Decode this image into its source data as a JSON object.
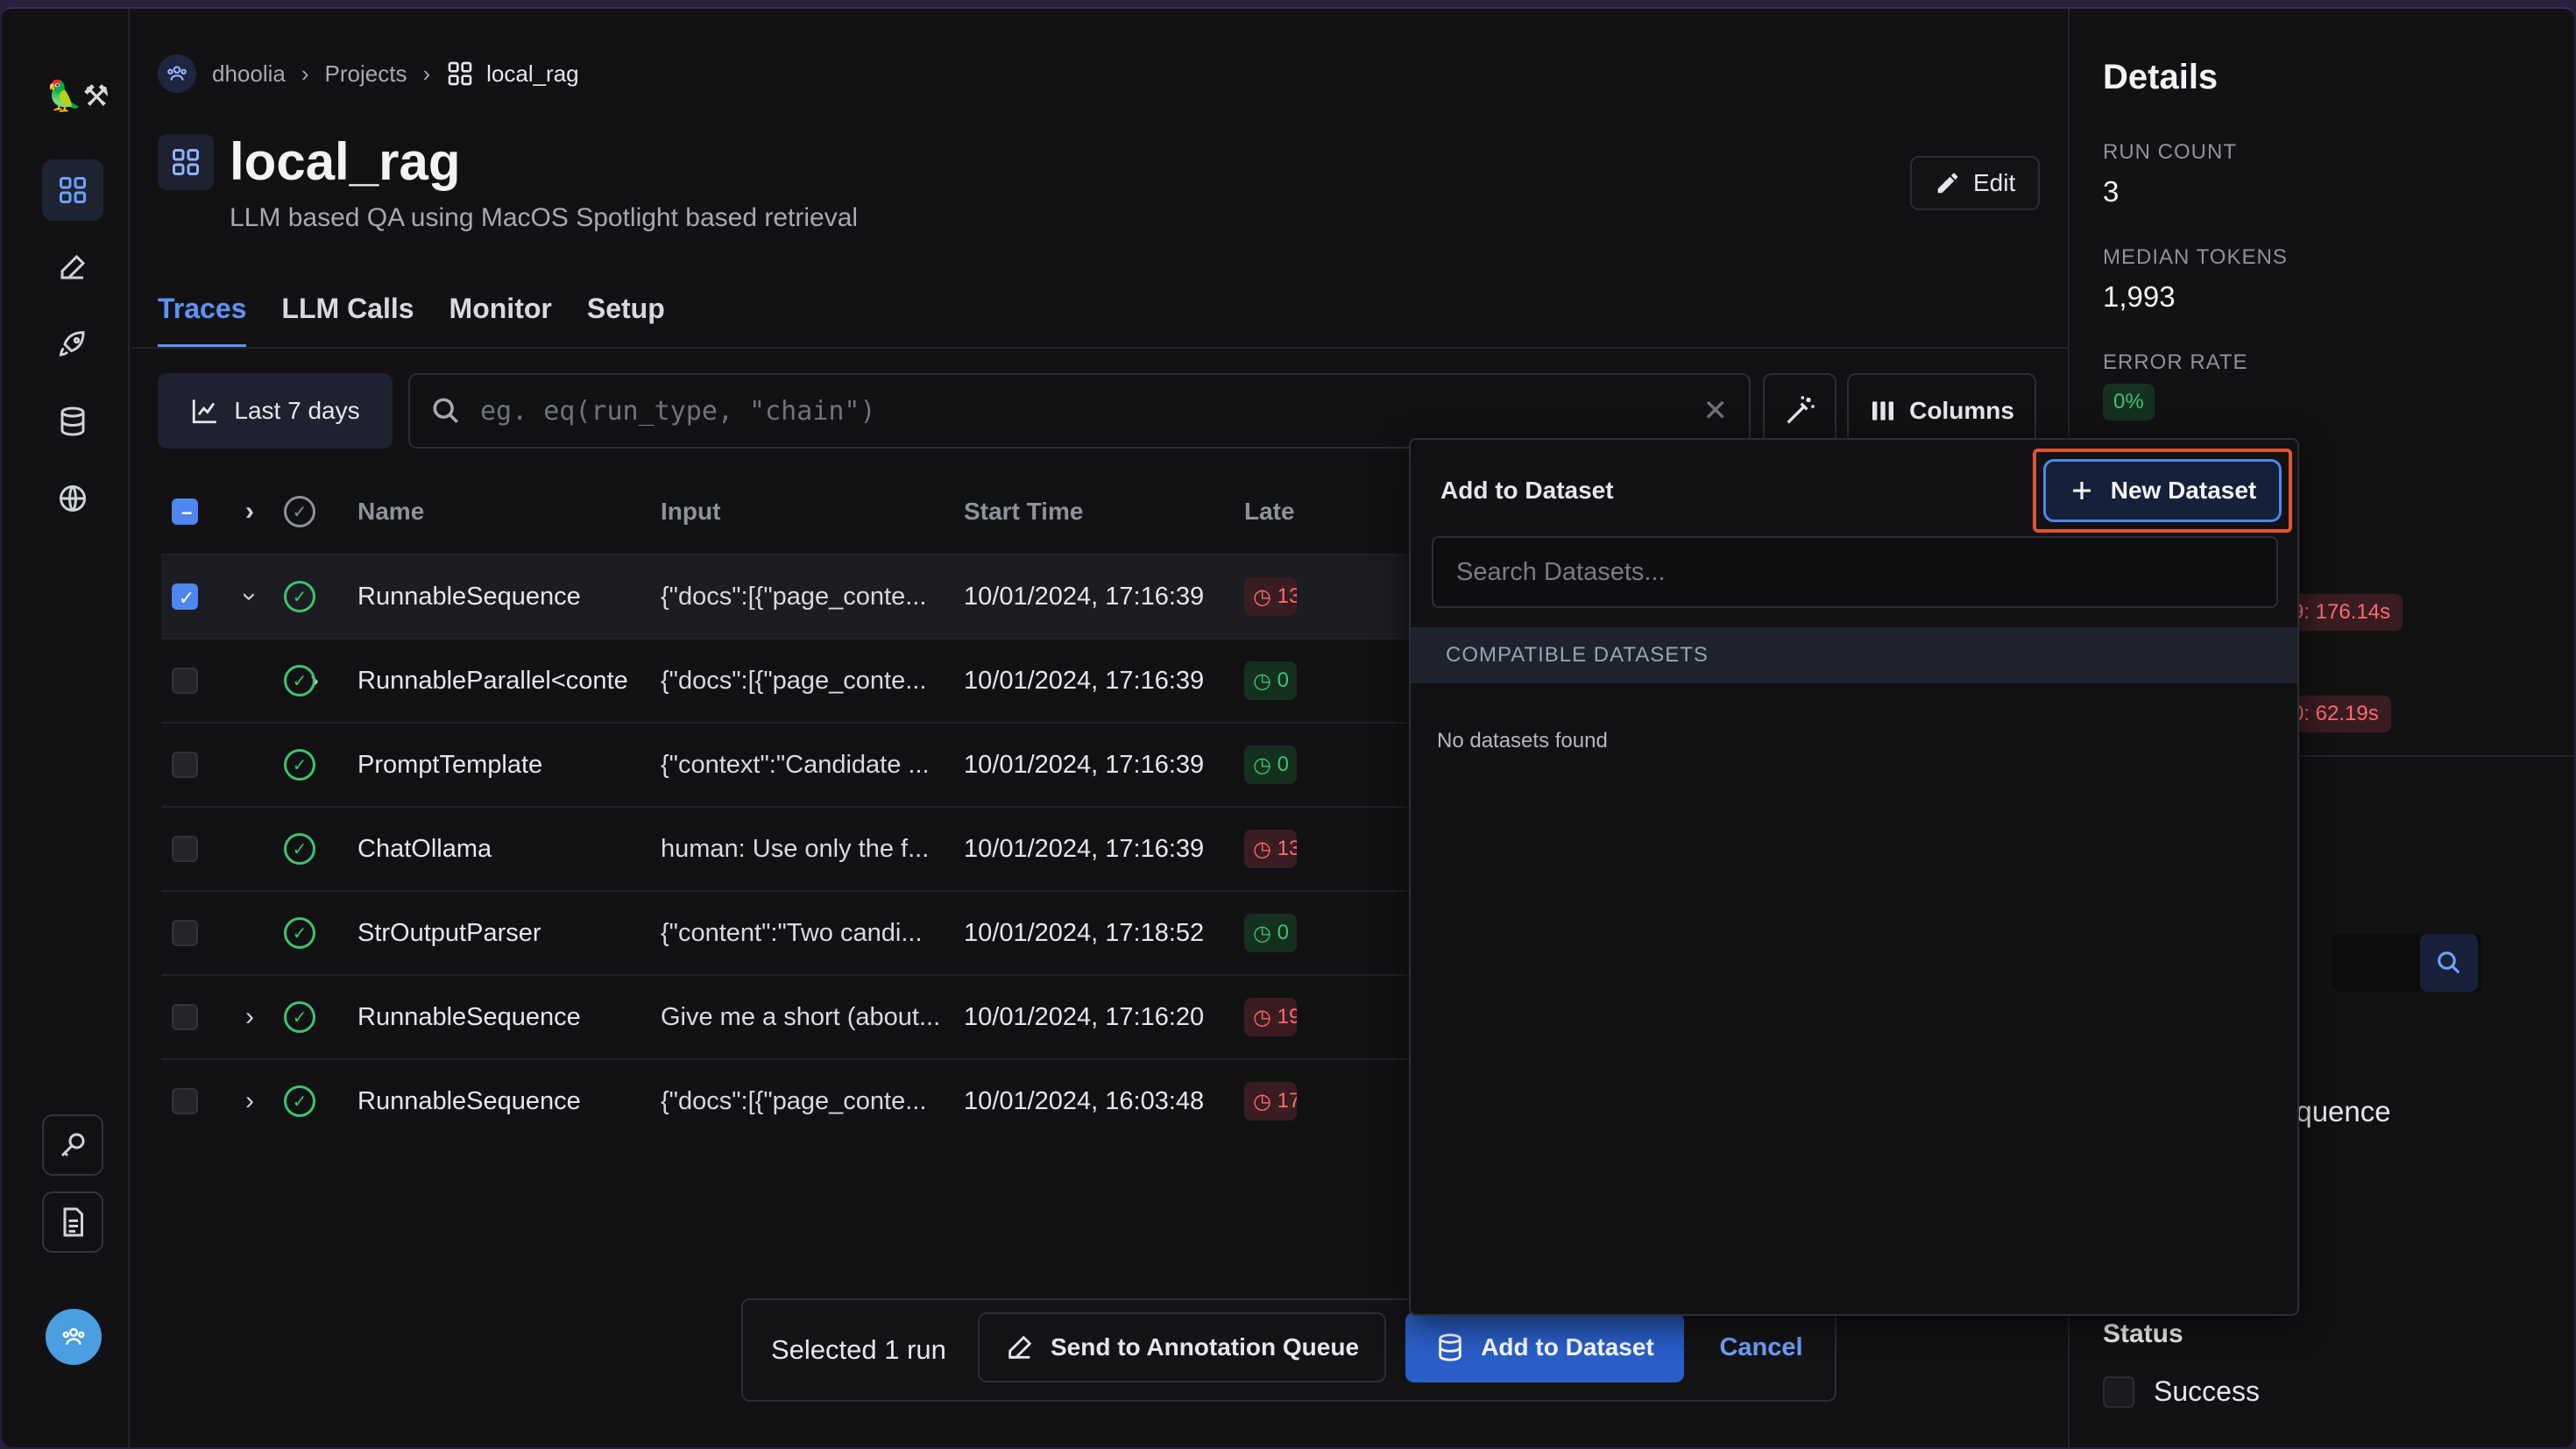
{
  "breadcrumb": {
    "org": "dhoolia",
    "section": "Projects",
    "current": "local_rag"
  },
  "project": {
    "title": "local_rag",
    "description": "LLM based QA using MacOS Spotlight based retrieval",
    "edit_label": "Edit"
  },
  "tabs": [
    {
      "label": "Traces"
    },
    {
      "label": "LLM Calls"
    },
    {
      "label": "Monitor"
    },
    {
      "label": "Setup"
    }
  ],
  "toolbar": {
    "range_label": "Last 7 days",
    "search_placeholder": "eg. eq(run_type, \"chain\")",
    "columns_label": "Columns"
  },
  "table": {
    "headers": {
      "name": "Name",
      "input": "Input",
      "start_time": "Start Time",
      "latency": "Late"
    },
    "rows": [
      {
        "name": "RunnableSequence",
        "input": "{\"docs\":[{\"page_conte...",
        "start_time": "10/01/2024, 17:16:39",
        "latency": "13",
        "latency_status": "red",
        "selected": true
      },
      {
        "name": "RunnableParallel<conte",
        "input": "{\"docs\":[{\"page_conte...",
        "start_time": "10/01/2024, 17:16:39",
        "latency": "0",
        "latency_status": "green",
        "selected": false
      },
      {
        "name": "PromptTemplate",
        "input": "{\"context\":\"Candidate ...",
        "start_time": "10/01/2024, 17:16:39",
        "latency": "0",
        "latency_status": "green",
        "selected": false
      },
      {
        "name": "ChatOllama",
        "input": "human: Use only the f...",
        "start_time": "10/01/2024, 17:16:39",
        "latency": "13",
        "latency_status": "red",
        "selected": false
      },
      {
        "name": "StrOutputParser",
        "input": "{\"content\":\"Two candi...",
        "start_time": "10/01/2024, 17:18:52",
        "latency": "0",
        "latency_status": "green",
        "selected": false
      },
      {
        "name": "RunnableSequence",
        "input": "Give me a short (about...",
        "start_time": "10/01/2024, 17:16:20",
        "latency": "19",
        "latency_status": "red",
        "selected": false
      },
      {
        "name": "RunnableSequence",
        "input": "{\"docs\":[{\"page_conte...",
        "start_time": "10/01/2024, 16:03:48",
        "latency": "17",
        "latency_status": "red",
        "selected": false
      }
    ]
  },
  "selection_bar": {
    "count_label": "Selected 1 run",
    "annotation_label": "Send to Annotation Queue",
    "add_dataset_label": "Add to Dataset",
    "cancel_label": "Cancel"
  },
  "details": {
    "title": "Details",
    "run_count_label": "RUN COUNT",
    "run_count": "3",
    "median_tokens_label": "MEDIAN TOKENS",
    "median_tokens": "1,993",
    "error_rate_label": "ERROR RATE",
    "error_rate": "0%",
    "latency_p99": "9: 176.14s",
    "latency_p50": "0: 62.19s",
    "name_value": "equence",
    "status_label": "Status",
    "status_option": "Success"
  },
  "popover": {
    "title": "Add to Dataset",
    "new_dataset_label": "New Dataset",
    "search_placeholder": "Search Datasets...",
    "section_label": "COMPATIBLE DATASETS",
    "empty_label": "No datasets found"
  },
  "colors": {
    "accent": "#5d93f7",
    "success": "#3ec46d",
    "error": "#ff6b6b",
    "highlight": "#e2532f"
  }
}
